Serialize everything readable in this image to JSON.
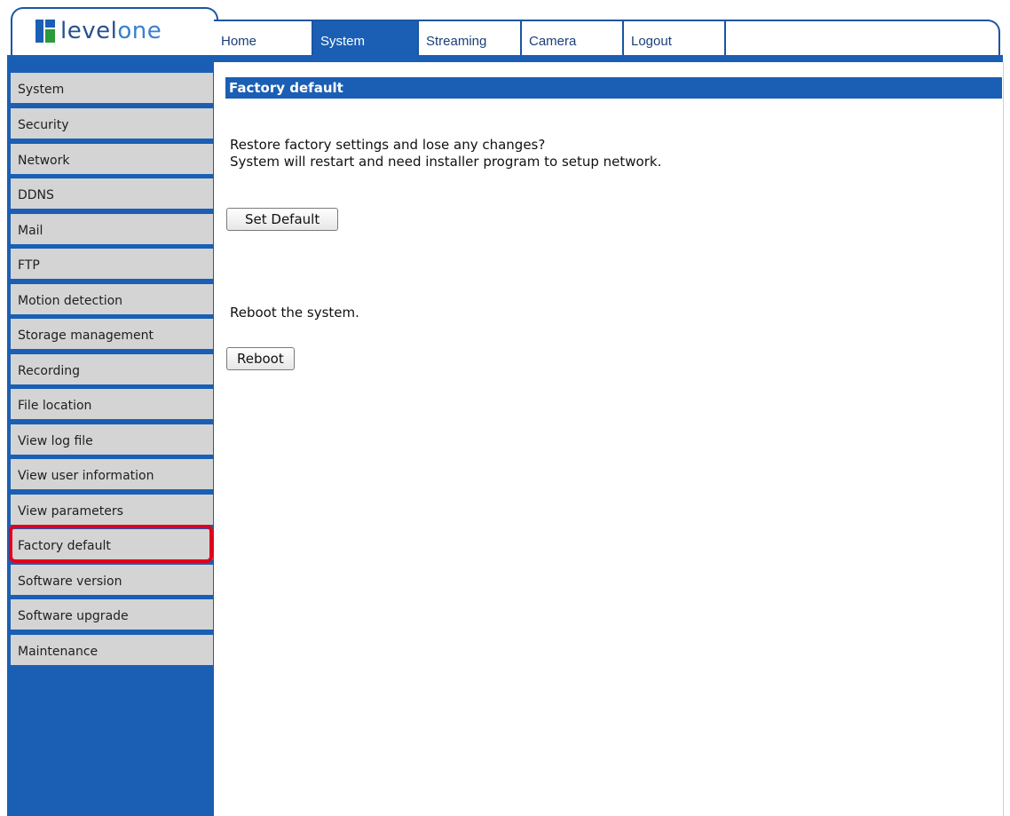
{
  "logo": {
    "text_main": "level",
    "text_accent": "one"
  },
  "nav": {
    "tabs": [
      {
        "label": "Home"
      },
      {
        "label": "System",
        "active": true
      },
      {
        "label": "Streaming"
      },
      {
        "label": "Camera"
      },
      {
        "label": "Logout"
      }
    ]
  },
  "sidebar": {
    "items": [
      {
        "label": "System"
      },
      {
        "label": "Security"
      },
      {
        "label": "Network"
      },
      {
        "label": "DDNS"
      },
      {
        "label": "Mail"
      },
      {
        "label": "FTP"
      },
      {
        "label": "Motion detection"
      },
      {
        "label": "Storage management"
      },
      {
        "label": "Recording"
      },
      {
        "label": "File location"
      },
      {
        "label": "View log file"
      },
      {
        "label": "View user information"
      },
      {
        "label": "View parameters"
      },
      {
        "label": "Factory default",
        "selected": true
      },
      {
        "label": "Software version"
      },
      {
        "label": "Software upgrade"
      },
      {
        "label": "Maintenance"
      }
    ]
  },
  "main": {
    "title": "Factory default",
    "restore_line1": "Restore factory settings and lose any changes?",
    "restore_line2": "System will restart and need installer program to setup network.",
    "set_default_label": "Set Default",
    "reboot_text": "Reboot the system.",
    "reboot_label": "Reboot"
  },
  "colors": {
    "accent": "#1a5fb4",
    "highlight": "#e3001b",
    "menu_bg": "#d4d4d4"
  }
}
